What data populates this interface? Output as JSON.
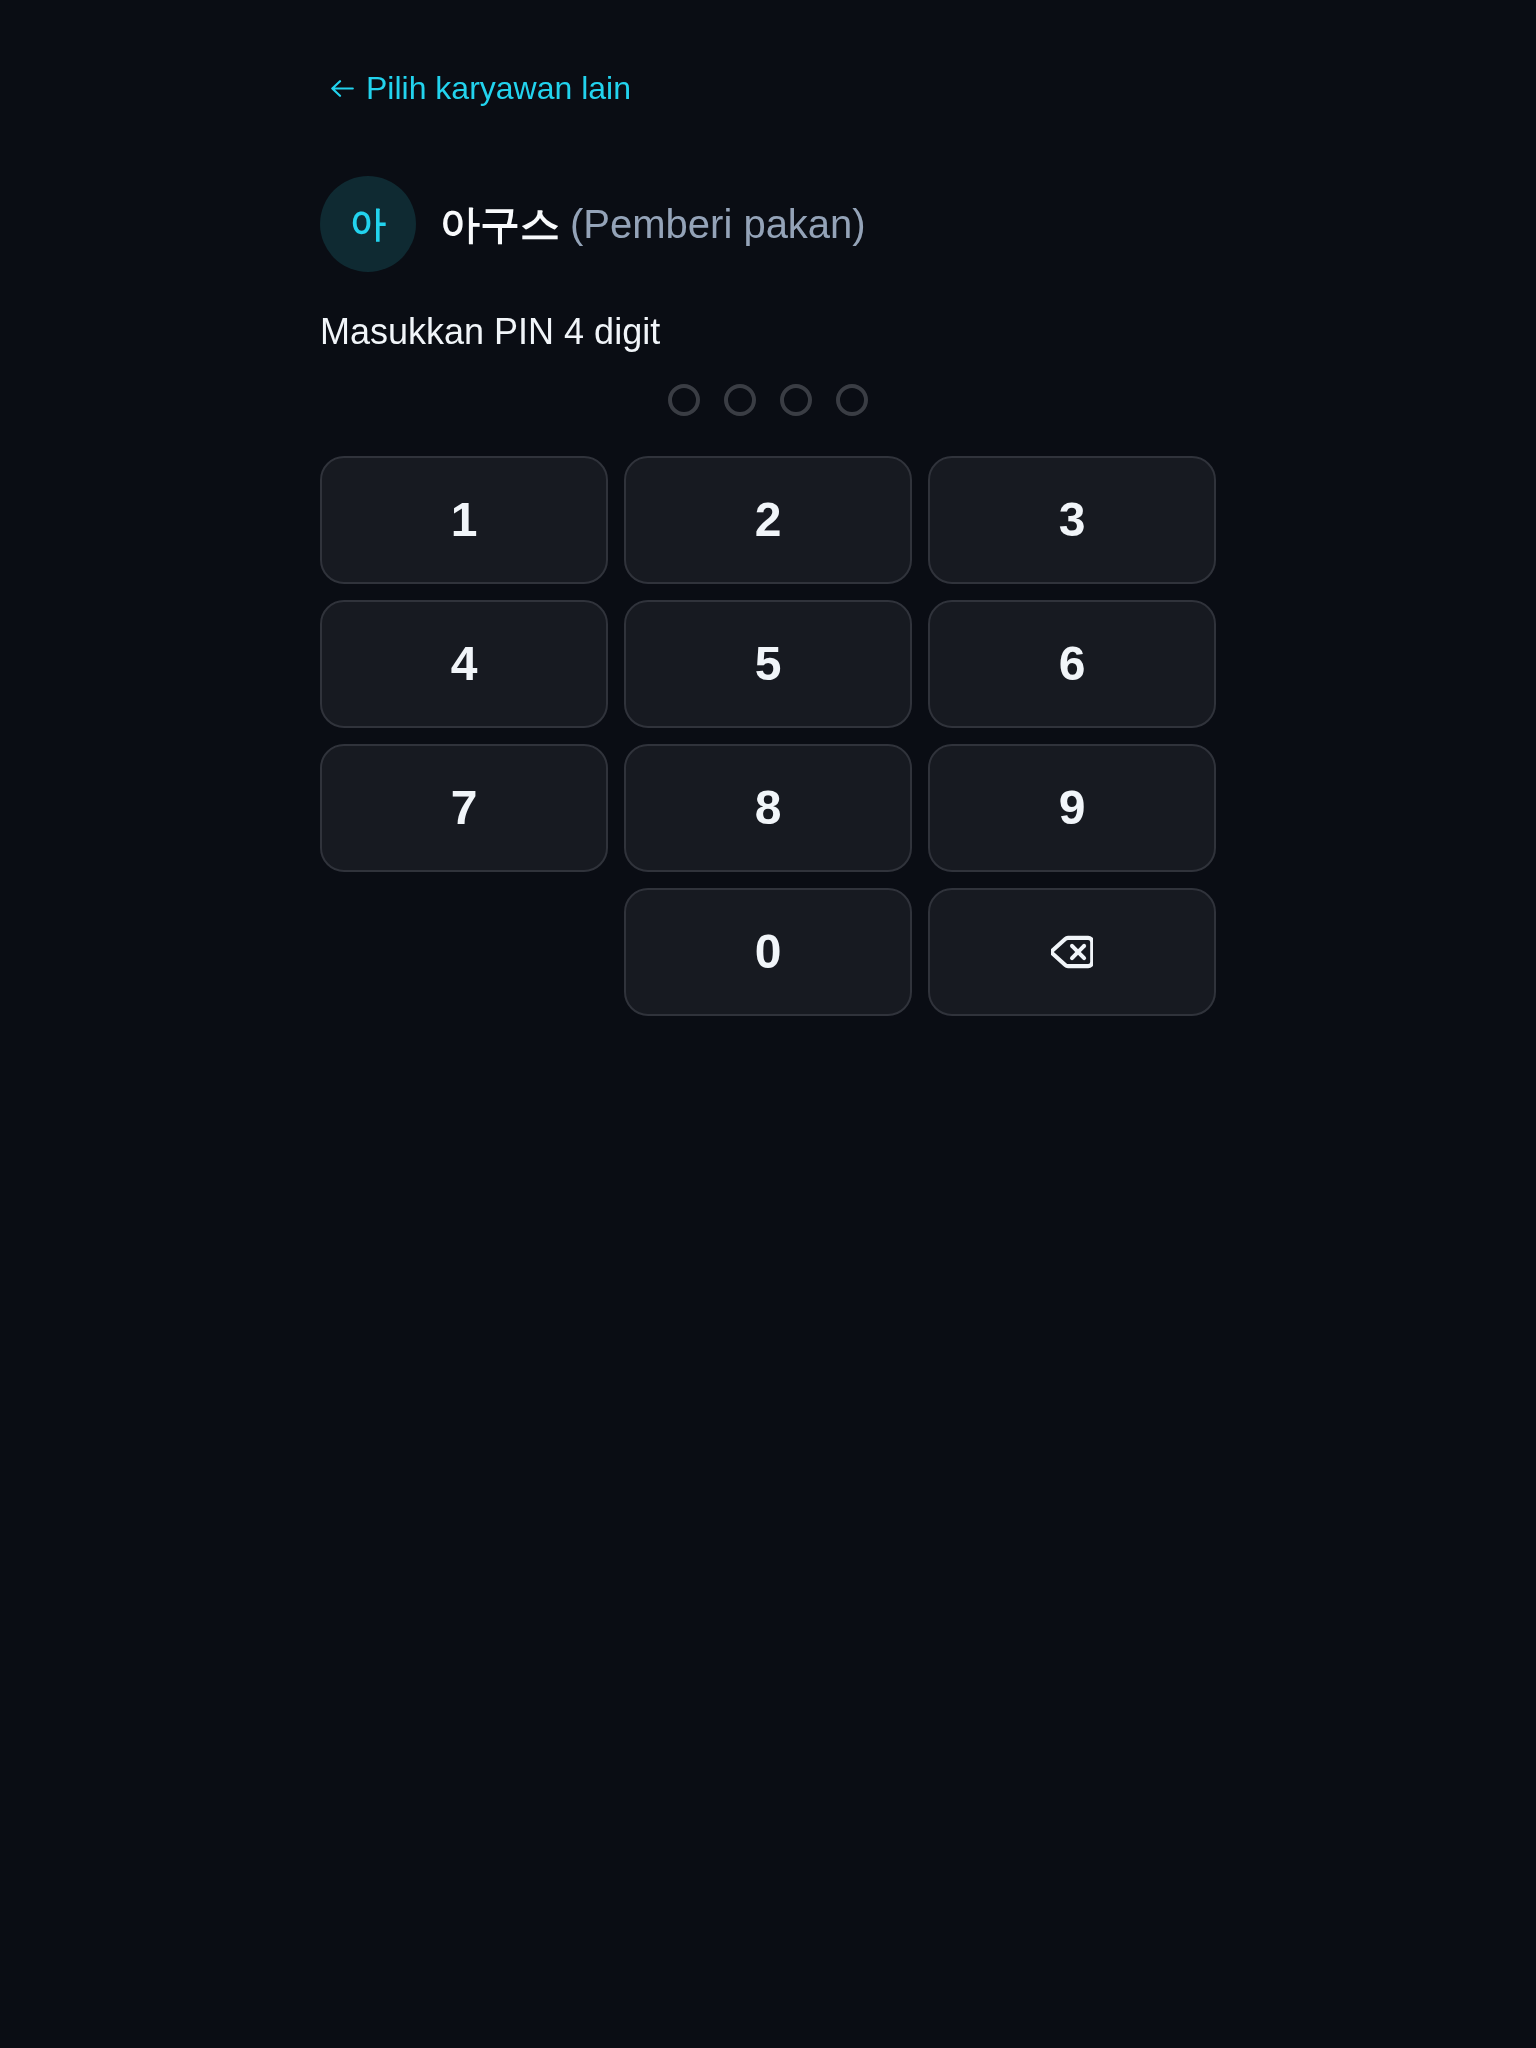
{
  "back_link": {
    "label": "Pilih karyawan lain"
  },
  "employee": {
    "initial": "아",
    "name": "아구스",
    "role": "(Pemberi pakan)"
  },
  "prompt": "Masukkan PIN 4 digit",
  "pin_dots": [
    {
      "filled": false
    },
    {
      "filled": false
    },
    {
      "filled": false
    },
    {
      "filled": false
    }
  ],
  "keypad": [
    {
      "kind": "digit",
      "label": "1"
    },
    {
      "kind": "digit",
      "label": "2"
    },
    {
      "kind": "digit",
      "label": "3"
    },
    {
      "kind": "digit",
      "label": "4"
    },
    {
      "kind": "digit",
      "label": "5"
    },
    {
      "kind": "digit",
      "label": "6"
    },
    {
      "kind": "digit",
      "label": "7"
    },
    {
      "kind": "digit",
      "label": "8"
    },
    {
      "kind": "digit",
      "label": "9"
    },
    {
      "kind": "digit",
      "label": "0"
    },
    {
      "kind": "backspace"
    }
  ]
}
